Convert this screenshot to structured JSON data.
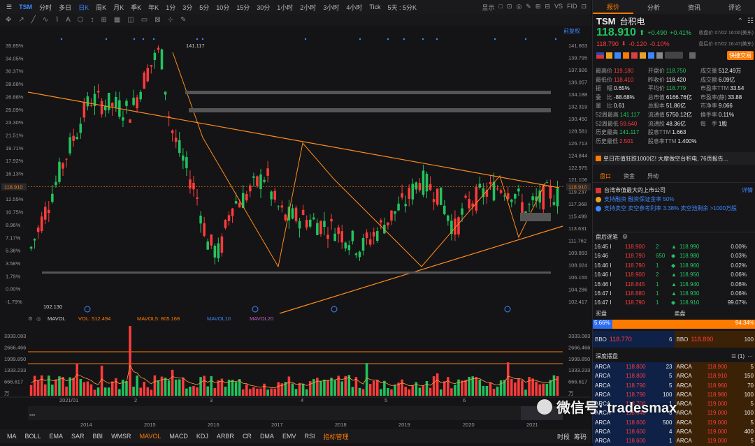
{
  "toolbar": {
    "symbol": "TSM",
    "periods": [
      "分时",
      "多日",
      "日K",
      "周K",
      "月K",
      "季K",
      "年K",
      "1分",
      "3分",
      "5分",
      "10分",
      "15分",
      "30分",
      "1小时",
      "2小时",
      "3小时",
      "4小时",
      "Tick"
    ],
    "selected_period": "日K",
    "range_select": "5天 : 5分K",
    "right_items": [
      "显示",
      "□",
      "⊡",
      "◎",
      "✎",
      "⊞",
      "⊟",
      "VS",
      "FID",
      "⊡"
    ]
  },
  "drawing_tools": [
    "✥",
    "↗",
    "╱",
    "∿",
    "⌇",
    "A",
    "⬡",
    "↕",
    "⊞",
    "▦",
    "◫",
    "▭",
    "⊠",
    "⊹",
    "✎"
  ],
  "chart": {
    "price_labels_left": [
      "35.85%",
      "34.05%",
      "30.37%",
      "28.68%",
      "26.88%",
      "25.09%",
      "23.30%",
      "21.51%",
      "19.71%",
      "17.92%",
      "16.13%",
      "14.34%",
      "12.55%",
      "10.75%",
      "8.96%",
      "7.17%",
      "5.38%",
      "3.58%",
      "1.79%",
      "0.00%",
      "-1.79%"
    ],
    "price_labels_right": [
      "141.663",
      "139.795",
      "137.926",
      "136.057",
      "134.188",
      "132.319",
      "130.450",
      "128.581",
      "126.713",
      "124.844",
      "122.975",
      "121.106",
      "119.237",
      "117.368",
      "115.499",
      "113.631",
      "111.762",
      "109.893",
      "108.024",
      "106.155",
      "104.286",
      "102.417"
    ],
    "current_price_left": "118.910",
    "current_price_right": "118.910",
    "high_marker": "141.117",
    "low_marker": "102.130",
    "restore_label": "前复权",
    "volume_indicator": {
      "name": "MAVOL",
      "vol": "VOL: 512.494",
      "mavol5": "MAVOL5: 805.168",
      "mavol10": "MAVOL10",
      "mavol20": "MAVOL20",
      "axis_left": [
        "3333.083",
        "2666.466",
        "1999.850",
        "1333.233",
        "666.617",
        "万"
      ],
      "axis_right": [
        "3333.083",
        "2666.466",
        "1999.850",
        "1333.233",
        "666.617",
        "万"
      ]
    },
    "x_months": [
      "2021/01",
      "2",
      "3",
      "4",
      "5",
      "6"
    ],
    "x_years": [
      "2014",
      "2015",
      "2016",
      "2017",
      "2018",
      "2019",
      "2020",
      "2021"
    ],
    "colors": {
      "up": "#22c35e",
      "down": "#ff3b3b",
      "trend": "#ff8c1a",
      "accent": "#3e86ff"
    }
  },
  "bottom_tabs": [
    "MA",
    "BOLL",
    "EMA",
    "SAR",
    "BBI",
    "WMSR",
    "MAVOL",
    "MACD",
    "KDJ",
    "ARBR",
    "CR",
    "DMA",
    "EMV",
    "RSI",
    "指标管理"
  ],
  "bottom_selected": "MAVOL",
  "bottom_right": [
    "时段",
    "筹码"
  ],
  "panel": {
    "tabs": [
      "报价",
      "分析",
      "资讯",
      "评论"
    ],
    "symbol": "TSM",
    "name": "台积电",
    "price": "118.910",
    "change": "+0.490",
    "change_pct": "+0.41%",
    "close_label": "收盘价 07/02 16:00(美东)",
    "ah_price": "118.790",
    "ah_change": "-0.120",
    "ah_pct": "-0.10%",
    "ah_label": "盘后价 07/02 16:47(美东)",
    "quick_trade": "快捷交易",
    "stats": [
      [
        [
          "最高价",
          "119.180",
          "red"
        ],
        [
          "开盘价",
          "118.750",
          "green"
        ],
        [
          "成交量",
          "512.49万",
          "white"
        ]
      ],
      [
        [
          "最低价",
          "118.410",
          "red"
        ],
        [
          "昨收价",
          "118.420",
          "white"
        ],
        [
          "成交额",
          "6.09亿",
          "white"
        ]
      ],
      [
        [
          "振　幅",
          "0.65%",
          "white"
        ],
        [
          "平均价",
          "118.779",
          "green"
        ],
        [
          "市盈率TTM",
          "33.54",
          "white"
        ]
      ],
      [
        [
          "委　比",
          "-88.68%",
          "white"
        ],
        [
          "总市值",
          "6166.76亿",
          "white"
        ],
        [
          "市盈率(静)",
          "33.88",
          "white"
        ]
      ],
      [
        [
          "量　比",
          "0.61",
          "white"
        ],
        [
          "总股本",
          "51.86亿",
          "white"
        ],
        [
          "市净率",
          "9.066",
          "white"
        ]
      ],
      [
        [
          "52周最高",
          "141.117",
          "green"
        ],
        [
          "流通值",
          "5750.12亿",
          "white"
        ],
        [
          "换手率",
          "0.11%",
          "white"
        ]
      ],
      [
        [
          "52周最低",
          "59.640",
          "red"
        ],
        [
          "流通股",
          "48.36亿",
          "white"
        ],
        [
          "每　手",
          "1股",
          "white"
        ]
      ],
      [
        [
          "历史最高",
          "141.117",
          "green"
        ],
        [
          "股息TTM",
          "1.663",
          "white"
        ],
        [
          "",
          "",
          " "
        ]
      ],
      [
        [
          "历史最低",
          "2.501",
          "red"
        ],
        [
          "股息率TTM",
          "1.400%",
          "white"
        ],
        [
          "",
          "",
          " "
        ]
      ]
    ],
    "news": "单日市值狂跌1000亿! 大摩做空台积电, 76页报告...",
    "sub_tabs": [
      "盘口",
      "资金",
      "异动"
    ],
    "company_info": "台湾市值最大的上市公司",
    "details_link": "详情",
    "margin1": "支持融资  融资保证金率 50%",
    "margin2": "支持卖空  卖空参考利率 3.38%  卖空池剩余 >1000万股",
    "ticks_title": "盘后逐笔",
    "ticks": [
      [
        "16:45 I",
        "118.900",
        "2",
        "▲",
        "118.990",
        "0.00%"
      ],
      [
        "16:46",
        "118.790",
        "650",
        "◆",
        "118.980",
        "0.03%"
      ],
      [
        "16:46 I",
        "118.790",
        "1",
        "◆",
        "118.960",
        "0.02%"
      ],
      [
        "16:46 I",
        "118.900",
        "2",
        "▲",
        "118.950",
        "0.06%"
      ],
      [
        "16:46 I",
        "118.845",
        "1",
        "▲",
        "118.940",
        "0.06%"
      ],
      [
        "16:47 I",
        "118.880",
        "1",
        "▲",
        "118.930",
        "0.06%"
      ],
      [
        "16:47 I",
        "118.790",
        "1",
        "◆",
        "118.910",
        "99.07%"
      ]
    ],
    "bid_label": "买盘",
    "ask_label": "卖盘",
    "bid_pct": "5.66%",
    "ask_pct": "94.34%",
    "bbo_bid": {
      "label": "BBO",
      "price": "118.770",
      "qty": "6"
    },
    "bbo_ask": {
      "label": "BBO",
      "price": "118.890",
      "qty": "100"
    },
    "depth_title": "深度摆盘",
    "depth_level": "(1)",
    "depth": [
      [
        [
          "ARCA",
          "118.800",
          "23"
        ],
        [
          "ARCA",
          "118.900",
          "5"
        ]
      ],
      [
        [
          "ARCA",
          "118.800",
          "5"
        ],
        [
          "ARCA",
          "118.910",
          "150"
        ]
      ],
      [
        [
          "ARCA",
          "118.790",
          "5"
        ],
        [
          "ARCA",
          "118.960",
          "70"
        ]
      ],
      [
        [
          "ARCA",
          "118.790",
          "100"
        ],
        [
          "ARCA",
          "118.980",
          "100"
        ]
      ],
      [
        [
          "ARCA",
          "118.700",
          "1"
        ],
        [
          "ARCA",
          "119.000",
          "5"
        ]
      ],
      [
        [
          "ARCA",
          "118.640",
          "3"
        ],
        [
          "ARCA",
          "119.000",
          "100"
        ]
      ],
      [
        [
          "ARCA",
          "118.600",
          "500"
        ],
        [
          "ARCA",
          "119.000",
          "5"
        ]
      ],
      [
        [
          "ARCA",
          "118.600",
          "4"
        ],
        [
          "ARCA",
          "119.000",
          "400"
        ]
      ],
      [
        [
          "ARCA",
          "118.600",
          "1"
        ],
        [
          "ARCA",
          "119.000",
          "5"
        ]
      ]
    ],
    "watermark": "微信号: tradesmax"
  }
}
